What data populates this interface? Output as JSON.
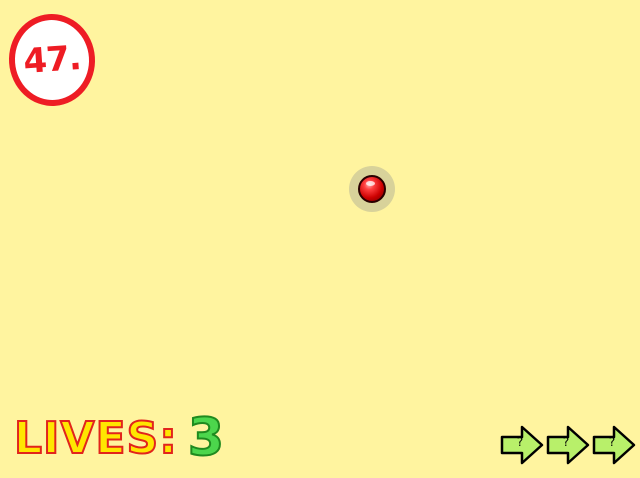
{
  "level": {
    "number": "47."
  },
  "lives": {
    "label": "LIVES:",
    "count": "3"
  },
  "skips": [
    {
      "label": "?"
    },
    {
      "label": "?"
    },
    {
      "label": "?"
    }
  ],
  "colors": {
    "background": "#fff49f",
    "level_red": "#ee1c24",
    "lives_yellow": "#ffe600",
    "lives_green": "#4cd64c",
    "arrow_green": "#b8f06a",
    "button_red": "#cc0000"
  },
  "icons": {
    "red_button": "red-button-icon",
    "skip": "arrow-right-icon"
  }
}
